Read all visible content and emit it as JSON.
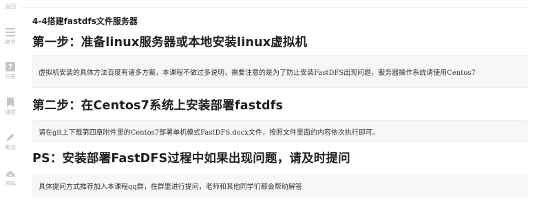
{
  "sidebar": {
    "items": [
      {
        "label": "返回",
        "icon": "back-icon"
      },
      {
        "label": "章节",
        "icon": "menu-icon"
      },
      {
        "label": "问答",
        "icon": "question-icon"
      },
      {
        "label": "课签",
        "icon": "bookmark-icon"
      },
      {
        "label": "笔记",
        "icon": "pencil-icon"
      },
      {
        "label": "资料",
        "icon": "cloud-download-icon"
      }
    ]
  },
  "content": {
    "course_title": "4-4搭建fastdfs文件服务器",
    "sections": [
      {
        "heading": "第一步：准备linux服务器或本地安装linux虚拟机",
        "note": "虚拟机安装的具体方法百度有诸多方案，本课程不做过多说明，需要注意的是为了防止安装FastDFS出现问题，服务器操作系统请使用Centos7"
      },
      {
        "heading": "第二步：在Centos7系统上安装部署fastdfs",
        "note": "请在git上下载第四章附件里的Centos7部署单机模式FastDFS.docx文件，按照文件里面的内容依次执行即可。"
      },
      {
        "heading": "PS：安装部署FastDFS过程中如果出现问题，请及时提问",
        "note": "具体提问方式推荐加入本课程qq群，在群里进行提问，老师和其他同学们都会帮助解答"
      }
    ]
  },
  "colors": {
    "sidebar_icon": "#c3c7ca",
    "sidebar_label": "#b5b9bc",
    "heading_text": "#1c1f21",
    "note_background": "#f6f7f8"
  }
}
